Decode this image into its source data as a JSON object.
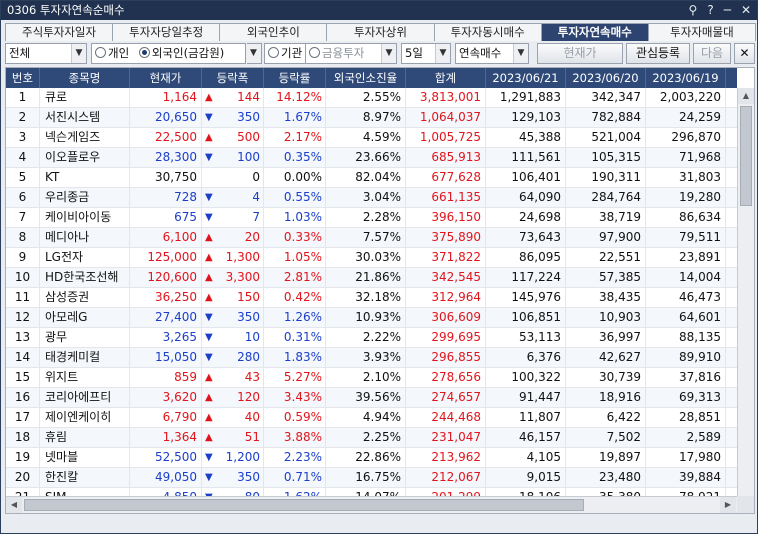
{
  "window": {
    "title": "0306 투자자연속순매수",
    "icons": [
      "⚲",
      "?",
      "─",
      "✕"
    ]
  },
  "tabs": [
    "주식투자자일자",
    "투자자당일추정",
    "외국인추이",
    "투자자상위",
    "투자자동시매수",
    "투자자연속매수",
    "투자자매물대"
  ],
  "active_tab": 5,
  "toolbar": {
    "market": "전체",
    "opt_individual": "개인",
    "opt_foreign": "외국인(금감원)",
    "opt_inst": "기관",
    "inst_select": "금융투자",
    "days": "5일",
    "mode": "연속매수",
    "btn_current": "현재가",
    "btn_watch": "관심등록",
    "btn_next": "다음"
  },
  "columns": [
    "번호",
    "종목명",
    "현재가",
    "등락폭",
    "등락률",
    "외국인소진율",
    "합계",
    "2023/06/21",
    "2023/06/20",
    "2023/06/19"
  ],
  "rows": [
    [
      "1",
      "큐로",
      "1,164",
      "up",
      "144",
      "14.12%",
      "2.55%",
      "3,813,001",
      "1,291,883",
      "342,347",
      "2,003,220"
    ],
    [
      "2",
      "서진시스템",
      "20,650",
      "dn",
      "350",
      "1.67%",
      "8.97%",
      "1,064,037",
      "129,103",
      "782,884",
      "24,259"
    ],
    [
      "3",
      "넥슨게임즈",
      "22,500",
      "up",
      "500",
      "2.17%",
      "4.59%",
      "1,005,725",
      "45,388",
      "521,004",
      "296,870"
    ],
    [
      "4",
      "이오플로우",
      "28,300",
      "dn",
      "100",
      "0.35%",
      "23.66%",
      "685,913",
      "111,561",
      "105,315",
      "71,968"
    ],
    [
      "5",
      "KT",
      "30,750",
      "",
      "0",
      "0.00%",
      "82.04%",
      "677,628",
      "106,401",
      "190,311",
      "31,803"
    ],
    [
      "6",
      "우리종금",
      "728",
      "dn",
      "4",
      "0.55%",
      "3.04%",
      "661,135",
      "64,090",
      "284,764",
      "19,280"
    ],
    [
      "7",
      "케이비아이동",
      "675",
      "dn",
      "7",
      "1.03%",
      "2.28%",
      "396,150",
      "24,698",
      "38,719",
      "86,634"
    ],
    [
      "8",
      "메디아나",
      "6,100",
      "up",
      "20",
      "0.33%",
      "7.57%",
      "375,890",
      "73,643",
      "97,900",
      "79,511"
    ],
    [
      "9",
      "LG전자",
      "125,000",
      "up",
      "1,300",
      "1.05%",
      "30.03%",
      "371,822",
      "86,095",
      "22,551",
      "23,891"
    ],
    [
      "10",
      "HD한국조선해",
      "120,600",
      "up",
      "3,300",
      "2.81%",
      "21.86%",
      "342,545",
      "117,224",
      "57,385",
      "14,004"
    ],
    [
      "11",
      "삼성증권",
      "36,250",
      "up",
      "150",
      "0.42%",
      "32.18%",
      "312,964",
      "145,976",
      "38,435",
      "46,473"
    ],
    [
      "12",
      "아모레G",
      "27,400",
      "dn",
      "350",
      "1.26%",
      "10.93%",
      "306,609",
      "106,851",
      "10,903",
      "64,601"
    ],
    [
      "13",
      "광무",
      "3,265",
      "dn",
      "10",
      "0.31%",
      "2.22%",
      "299,695",
      "53,113",
      "36,997",
      "88,135"
    ],
    [
      "14",
      "태경케미컬",
      "15,050",
      "dn",
      "280",
      "1.83%",
      "3.93%",
      "296,855",
      "6,376",
      "42,627",
      "89,910"
    ],
    [
      "15",
      "위지트",
      "859",
      "up",
      "43",
      "5.27%",
      "2.10%",
      "278,656",
      "100,322",
      "30,739",
      "37,816"
    ],
    [
      "16",
      "코리아에프티",
      "3,620",
      "up",
      "120",
      "3.43%",
      "39.56%",
      "274,657",
      "91,447",
      "18,916",
      "69,313"
    ],
    [
      "17",
      "제이엔케이히",
      "6,790",
      "up",
      "40",
      "0.59%",
      "4.94%",
      "244,468",
      "11,807",
      "6,422",
      "28,851"
    ],
    [
      "18",
      "휴림",
      "1,364",
      "up",
      "51",
      "3.88%",
      "2.25%",
      "231,047",
      "46,157",
      "7,502",
      "2,589"
    ],
    [
      "19",
      "넷마블",
      "52,500",
      "dn",
      "1,200",
      "2.23%",
      "22.86%",
      "213,962",
      "4,105",
      "19,897",
      "17,980"
    ],
    [
      "20",
      "한진칼",
      "49,050",
      "dn",
      "350",
      "0.71%",
      "16.75%",
      "212,067",
      "9,015",
      "23,480",
      "39,884"
    ],
    [
      "21",
      "SJM",
      "4,850",
      "dn",
      "80",
      "1.62%",
      "14.07%",
      "201,299",
      "18,106",
      "35,380",
      "78,921"
    ]
  ]
}
